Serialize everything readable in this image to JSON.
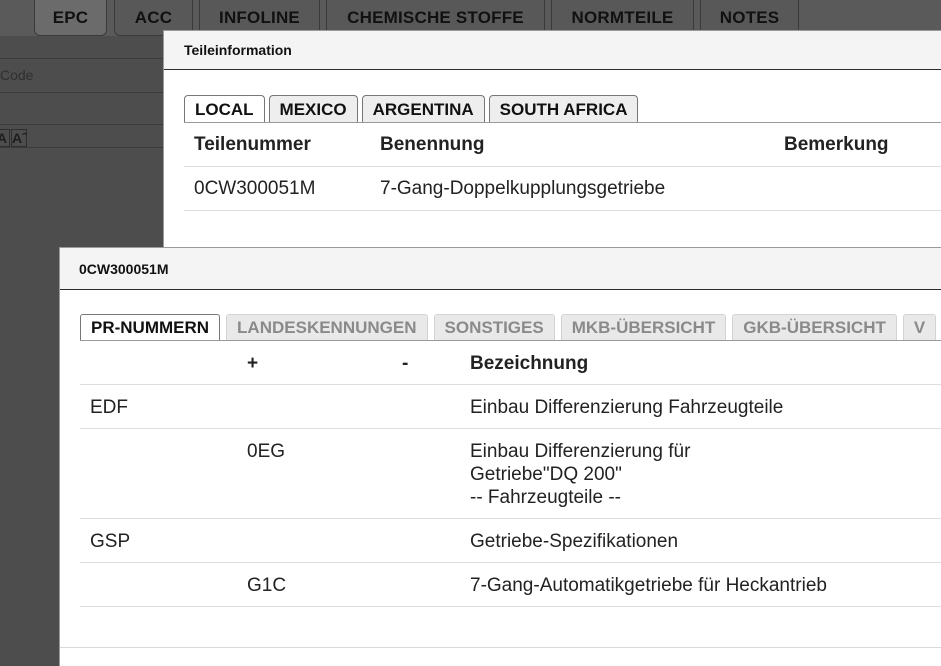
{
  "topnav": {
    "tabs": [
      {
        "label": "EPC",
        "active": true
      },
      {
        "label": "ACC",
        "active": false
      },
      {
        "label": "INFOLINE",
        "active": false
      },
      {
        "label": "CHEMISCHE STOFFE",
        "active": false
      },
      {
        "label": "NORMTEILE",
        "active": false
      },
      {
        "label": "NOTES",
        "active": false
      }
    ]
  },
  "background": {
    "code_placeholder": "Code",
    "font_small": "A",
    "font_large": "Aˆ"
  },
  "teileinformation": {
    "title": "Teileinformation",
    "market_tabs": [
      {
        "label": "LOCAL",
        "active": true
      },
      {
        "label": "MEXICO",
        "active": false
      },
      {
        "label": "ARGENTINA",
        "active": false
      },
      {
        "label": "SOUTH AFRICA",
        "active": false
      }
    ],
    "columns": {
      "part_number": "Teilenummer",
      "name": "Benennung",
      "remark": "Bemerkung"
    },
    "rows": [
      {
        "part_number": "0CW300051M",
        "name": "7-Gang-Doppelkupplungsgetriebe",
        "remark": ""
      }
    ]
  },
  "part_dialog": {
    "title": "0CW300051M",
    "tabs": [
      {
        "label": "PR-NUMMERN",
        "active": true
      },
      {
        "label": "LANDESKENNUNGEN",
        "active": false
      },
      {
        "label": "SONSTIGES",
        "active": false
      },
      {
        "label": "MKB-ÜBERSICHT",
        "active": false
      },
      {
        "label": "GKB-ÜBERSICHT",
        "active": false
      },
      {
        "label": "V",
        "active": false
      }
    ],
    "columns": {
      "code": "",
      "plus": "+",
      "minus": "-",
      "description": "Bezeichnung"
    },
    "rows": [
      {
        "code": "EDF",
        "plus": "",
        "minus": "",
        "description": "Einbau Differenzierung Fahrzeugteile"
      },
      {
        "code": "",
        "plus": "0EG",
        "minus": "",
        "description": "Einbau Differenzierung für\nGetriebe\"DQ 200\"\n-- Fahrzeugteile --"
      },
      {
        "code": "GSP",
        "plus": "",
        "minus": "",
        "description": "Getriebe-Spezifikationen"
      },
      {
        "code": "",
        "plus": "G1C",
        "minus": "",
        "description": "7-Gang-Automatikgetriebe für Heckantrieb"
      }
    ]
  }
}
